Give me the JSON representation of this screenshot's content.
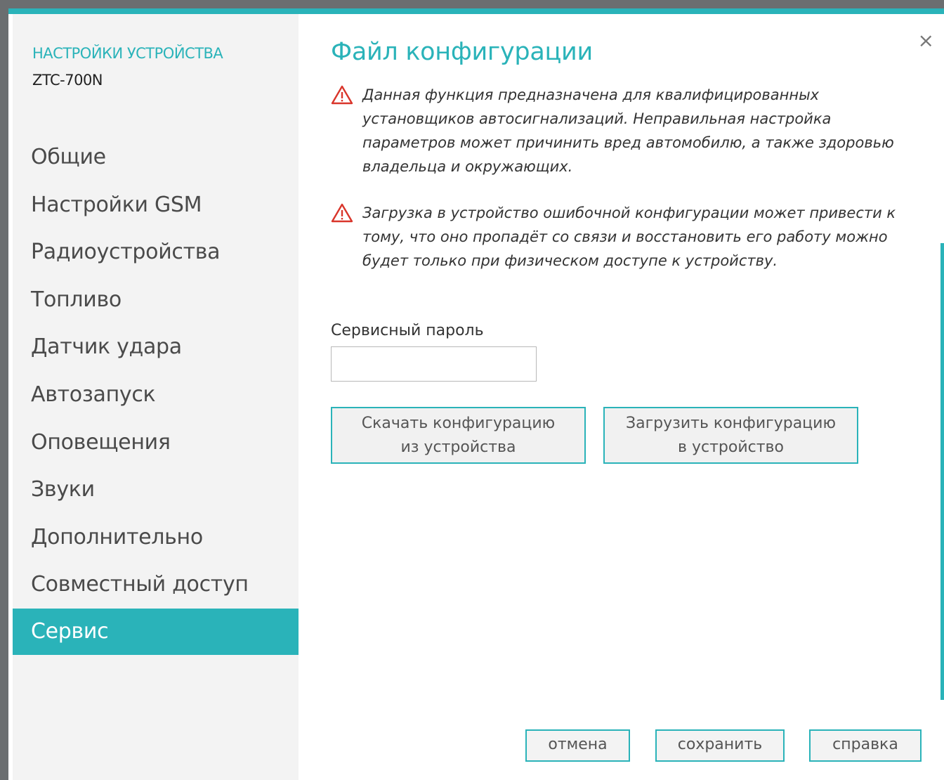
{
  "sidebar": {
    "header": "НАСТРОЙКИ УСТРОЙСТВА",
    "device": "ZTC-700N",
    "items": [
      {
        "label": "Общие"
      },
      {
        "label": "Настройки GSM"
      },
      {
        "label": "Радиоустройства"
      },
      {
        "label": "Топливо"
      },
      {
        "label": "Датчик удара"
      },
      {
        "label": "Автозапуск"
      },
      {
        "label": "Оповещения"
      },
      {
        "label": "Звуки"
      },
      {
        "label": "Дополнительно"
      },
      {
        "label": "Совместный доступ"
      },
      {
        "label": "Сервис",
        "active": true
      }
    ]
  },
  "main": {
    "title": "Файл конфигурации",
    "close_symbol": "×",
    "warnings": [
      "Данная функция предназначена для квалифицированных установщиков автосигнализаций. Неправильная настройка параметров может причинить вред автомобилю, а также здоровью владельца и окружающих.",
      "Загрузка в устройство ошибочной конфигурации может привести к тому, что оно пропадёт со связи и восстановить его работу можно будет только при физическом доступе к устройству."
    ],
    "password": {
      "label": "Сервисный пароль",
      "value": ""
    },
    "download_button": {
      "line1": "Скачать конфигурацию",
      "line2": "из устройства"
    },
    "upload_button": {
      "line1": "Загрузить конфигурацию",
      "line2": "в устройство"
    }
  },
  "footer": {
    "cancel": "отмена",
    "save": "сохранить",
    "help": "справка"
  },
  "colors": {
    "accent": "#2ab3b9",
    "warning": "#d9352b"
  }
}
